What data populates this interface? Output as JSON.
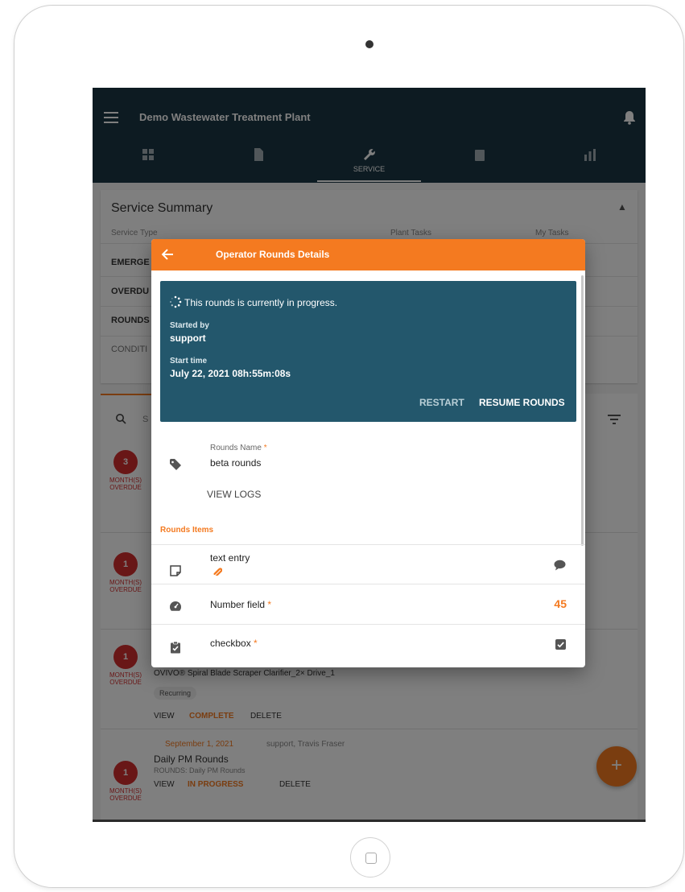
{
  "app": {
    "title": "Demo Wastewater Treatment Plant",
    "tabs": [
      {
        "label": "",
        "icon": "dashboard-icon"
      },
      {
        "label": "",
        "icon": "document-icon"
      },
      {
        "label": "SERVICE",
        "icon": "wrench-icon"
      },
      {
        "label": "",
        "icon": "clipboard-icon"
      },
      {
        "label": "",
        "icon": "chart-icon"
      }
    ],
    "active_tab": "SERVICE"
  },
  "summary": {
    "title": "Service Summary",
    "columns": {
      "type": "Service Type",
      "plant": "Plant Tasks",
      "mine": "My Tasks"
    },
    "rows": [
      "EMERGE",
      "OVERDU",
      "ROUNDS",
      "CONDITI"
    ]
  },
  "list": {
    "search_hint": "S",
    "tasks": [
      {
        "count": "3",
        "caption": "MONTH(S) OVERDUE"
      },
      {
        "count": "1",
        "caption": "MONTH(S) OVERDUE"
      },
      {
        "count": "1",
        "caption": "MONTH(S) OVERDUE",
        "equipment": "OVIVO® Spiral Blade Scraper Clarifier_2× Drive_1",
        "chip": "Recurring",
        "actions": {
          "view": "VIEW",
          "complete": "COMPLETE",
          "delete": "DELETE"
        }
      },
      {
        "count": "1",
        "caption": "MONTH(S) OVERDUE",
        "date": "September 1, 2021",
        "assignees": "support, Travis Fraser",
        "title": "Daily PM Rounds",
        "subtitle": "ROUNDS: Daily PM Rounds",
        "actions": {
          "view": "VIEW",
          "progress": "IN PROGRESS",
          "delete": "DELETE"
        }
      }
    ],
    "fab_label": "+"
  },
  "dialog": {
    "title": "Operator Rounds Details",
    "status": {
      "message": "This rounds is currently in progress.",
      "started_by_label": "Started by",
      "started_by": "support",
      "start_time_label": "Start time",
      "start_time": "July 22, 2021 08h:55m:08s",
      "restart": "RESTART",
      "resume": "RESUME ROUNDS"
    },
    "rounds_name_label": "Rounds Name",
    "required_mark": "*",
    "rounds_name": "beta rounds",
    "view_logs": "VIEW LOGS",
    "items_header": "Rounds Items",
    "items": [
      {
        "label": "text entry",
        "icon": "note-icon",
        "required": false
      },
      {
        "label": "Number field",
        "icon": "gauge-icon",
        "required": true,
        "value": "45"
      },
      {
        "label": "checkbox",
        "icon": "clipboard-check-icon",
        "required": true,
        "checked": true
      }
    ]
  },
  "colors": {
    "accent": "#f47a20",
    "appbar": "#1b3744",
    "status_card": "#23576c",
    "overdue": "#d32f2f"
  }
}
